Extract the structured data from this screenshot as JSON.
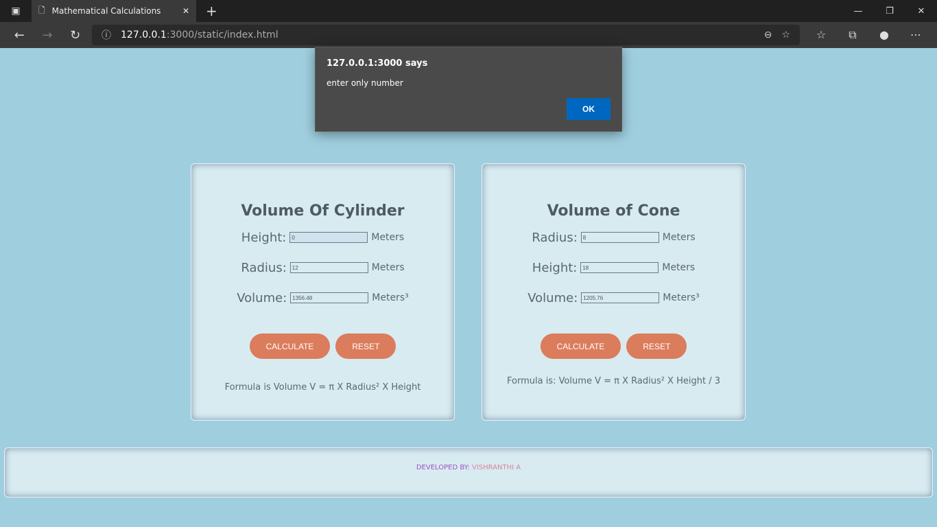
{
  "browser": {
    "tab_title": "Mathematical Calculations",
    "url_host": "127.0.0.1",
    "url_rest": ":3000/static/index.html"
  },
  "dialog": {
    "title": "127.0.0.1:3000 says",
    "message": "enter only number",
    "ok": "OK"
  },
  "cylinder": {
    "title": "Volume Of Cylinder",
    "height_label": "Height:",
    "height": "0",
    "radius_label": "Radius:",
    "radius": "12",
    "volume_label": "Volume:",
    "volume": "1356.48",
    "unit": "Meters",
    "unit3": "Meters³",
    "calculate": "CALCULATE",
    "reset": "RESET",
    "formula": "Formula is Volume V = π X Radius² X Height"
  },
  "cone": {
    "title": "Volume of Cone",
    "radius_label": "Radius:",
    "radius": "8",
    "height_label": "Height:",
    "height": "18",
    "volume_label": "Volume:",
    "volume": "1205.76",
    "unit": "Meters",
    "unit3": "Meters³",
    "calculate": "CALCULATE",
    "reset": "RESET",
    "formula": "Formula is: Volume V = π X Radius² X Height / 3"
  },
  "footer": {
    "developed_by": "DEVELOPED BY: ",
    "name": "VISHRANTHI A"
  }
}
